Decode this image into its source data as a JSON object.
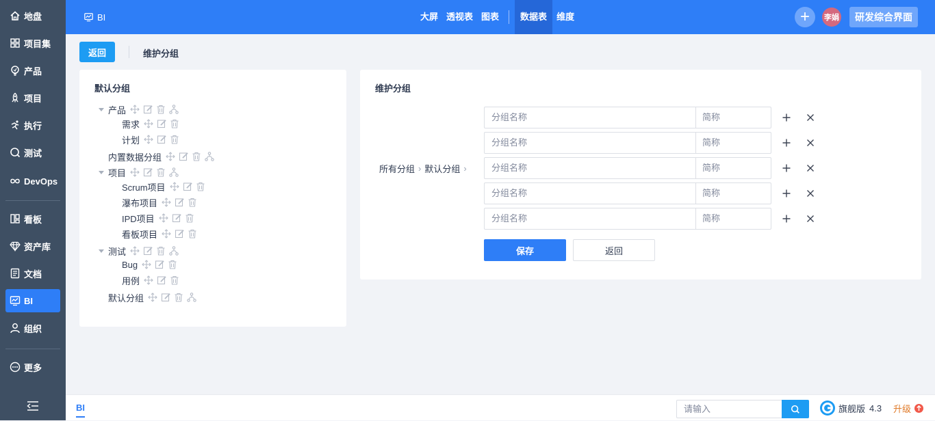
{
  "sidebar": {
    "items": [
      {
        "label": "地盘"
      },
      {
        "label": "项目集"
      },
      {
        "label": "产品"
      },
      {
        "label": "项目"
      },
      {
        "label": "执行"
      },
      {
        "label": "测试"
      },
      {
        "label": "DevOps"
      },
      {
        "label": "看板"
      },
      {
        "label": "资产库"
      },
      {
        "label": "文档"
      },
      {
        "label": "BI",
        "active": true
      },
      {
        "label": "组织"
      },
      {
        "label": "更多"
      }
    ]
  },
  "topbar": {
    "app_name": "BI",
    "nav": [
      "大屏",
      "透视表",
      "图表",
      "数据表",
      "维度"
    ],
    "active_nav": "数据表",
    "avatar_text": "李娟",
    "vision_label": "研发综合界面",
    "accent": "#2e7ef7"
  },
  "header": {
    "back_label": "返回",
    "page_title": "维护分组"
  },
  "left_panel": {
    "title": "默认分组",
    "tree": [
      {
        "label": "产品",
        "level": 0,
        "expanded": true
      },
      {
        "label": "需求",
        "level": 1
      },
      {
        "label": "计划",
        "level": 1
      },
      {
        "label": "内置数据分组",
        "level": 0
      },
      {
        "label": "项目",
        "level": 0,
        "expanded": true
      },
      {
        "label": "Scrum项目",
        "level": 1
      },
      {
        "label": "瀑布项目",
        "level": 1
      },
      {
        "label": "IPD项目",
        "level": 1
      },
      {
        "label": "看板项目",
        "level": 1
      },
      {
        "label": "测试",
        "level": 0,
        "expanded": true
      },
      {
        "label": "Bug",
        "level": 1
      },
      {
        "label": "用例",
        "level": 1
      },
      {
        "label": "默认分组",
        "level": 0
      }
    ]
  },
  "right_panel": {
    "title": "维护分组",
    "path": [
      "所有分组",
      "默认分组"
    ],
    "rows": [
      {
        "name_placeholder": "分组名称",
        "abbr_placeholder": "简称"
      },
      {
        "name_placeholder": "分组名称",
        "abbr_placeholder": "简称"
      },
      {
        "name_placeholder": "分组名称",
        "abbr_placeholder": "简称"
      },
      {
        "name_placeholder": "分组名称",
        "abbr_placeholder": "简称"
      },
      {
        "name_placeholder": "分组名称",
        "abbr_placeholder": "简称"
      }
    ],
    "save_label": "保存",
    "return_label": "返回"
  },
  "bottombar": {
    "tab": "BI",
    "search_placeholder": "请输入",
    "edition": "旗舰版",
    "version": "4.3",
    "upgrade_label": "升级"
  }
}
